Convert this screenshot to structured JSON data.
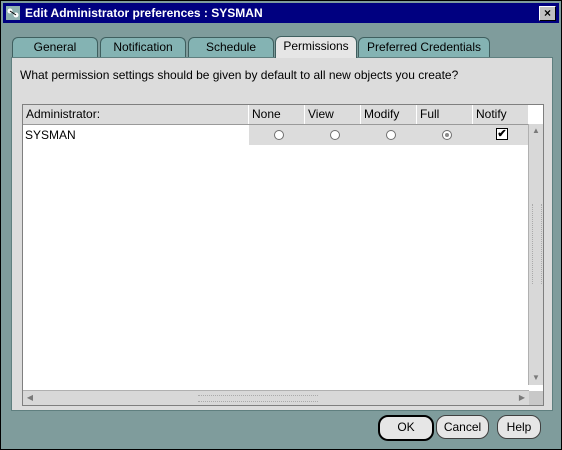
{
  "window": {
    "title": "Edit Administrator preferences : SYSMAN",
    "close_label": "×"
  },
  "tabs": [
    {
      "label": "General"
    },
    {
      "label": "Notification"
    },
    {
      "label": "Schedule"
    },
    {
      "label": "Permissions",
      "active": true
    },
    {
      "label": "Preferred Credentials"
    }
  ],
  "panel": {
    "prompt": "What permission settings should be given by default to all new objects you create?"
  },
  "table": {
    "columns": [
      "Administrator:",
      "None",
      "View",
      "Modify",
      "Full",
      "Notify"
    ],
    "rows": [
      {
        "name": "SYSMAN",
        "permission": "Full",
        "notify": true,
        "notify_mark": "✔"
      }
    ]
  },
  "scrollbars": {
    "up_icon": "▲",
    "down_icon": "▼",
    "left_icon": "◀",
    "right_icon": "▶"
  },
  "buttons": {
    "ok": "OK",
    "cancel": "Cancel",
    "help": "Help"
  }
}
